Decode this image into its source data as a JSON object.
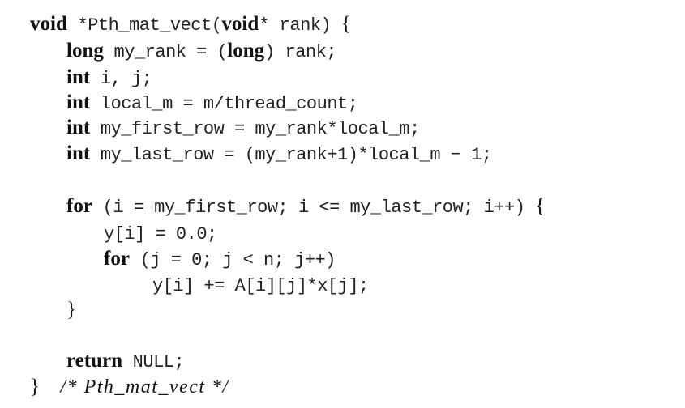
{
  "listing": {
    "lines": [
      {
        "indent": 0,
        "segments": [
          {
            "t": "kw",
            "v": "void"
          },
          {
            "t": "code",
            "v": " *Pth_mat_vect("
          },
          {
            "t": "kw",
            "v": "void"
          },
          {
            "t": "code",
            "v": "* rank) "
          },
          {
            "t": "op",
            "v": "{"
          }
        ]
      },
      {
        "indent": 1,
        "segments": [
          {
            "t": "kw",
            "v": "long"
          },
          {
            "t": "code",
            "v": " my_rank = ("
          },
          {
            "t": "kw",
            "v": "long"
          },
          {
            "t": "code",
            "v": ") rank;"
          }
        ]
      },
      {
        "indent": 1,
        "segments": [
          {
            "t": "kw",
            "v": "int"
          },
          {
            "t": "code",
            "v": " i, j;"
          }
        ]
      },
      {
        "indent": 1,
        "segments": [
          {
            "t": "kw",
            "v": "int"
          },
          {
            "t": "code",
            "v": " local_m = m/thread_count;"
          }
        ]
      },
      {
        "indent": 1,
        "segments": [
          {
            "t": "kw",
            "v": "int"
          },
          {
            "t": "code",
            "v": " my_first_row = my_rank*local_m;"
          }
        ]
      },
      {
        "indent": 1,
        "segments": [
          {
            "t": "kw",
            "v": "int"
          },
          {
            "t": "code",
            "v": " my_last_row = (my_rank+1)*local_m − 1;"
          }
        ]
      },
      {
        "indent": 1,
        "segments": []
      },
      {
        "indent": 1,
        "segments": [
          {
            "t": "kw",
            "v": "for"
          },
          {
            "t": "code",
            "v": " (i = my_first_row; i <= my_last_row; i++) "
          },
          {
            "t": "op",
            "v": "{"
          }
        ]
      },
      {
        "indent": 2,
        "segments": [
          {
            "t": "code",
            "v": "y[i] = 0.0;"
          }
        ]
      },
      {
        "indent": 2,
        "segments": [
          {
            "t": "kw",
            "v": "for"
          },
          {
            "t": "code",
            "v": " (j = 0; j < n; j++)"
          }
        ]
      },
      {
        "indent": 3,
        "segments": [
          {
            "t": "code",
            "v": "y[i] += A[i][j]*x[j];"
          }
        ]
      },
      {
        "indent": 1,
        "segments": [
          {
            "t": "op",
            "v": "}"
          }
        ]
      },
      {
        "indent": 1,
        "segments": []
      },
      {
        "indent": 1,
        "segments": [
          {
            "t": "kw",
            "v": "return"
          },
          {
            "t": "code",
            "v": " NULL;"
          }
        ]
      },
      {
        "indent": 0,
        "segments": [
          {
            "t": "op",
            "v": "}"
          },
          {
            "t": "code",
            "v": "  "
          },
          {
            "t": "cm",
            "v": "/* Pth_mat_vect */"
          }
        ]
      }
    ]
  }
}
